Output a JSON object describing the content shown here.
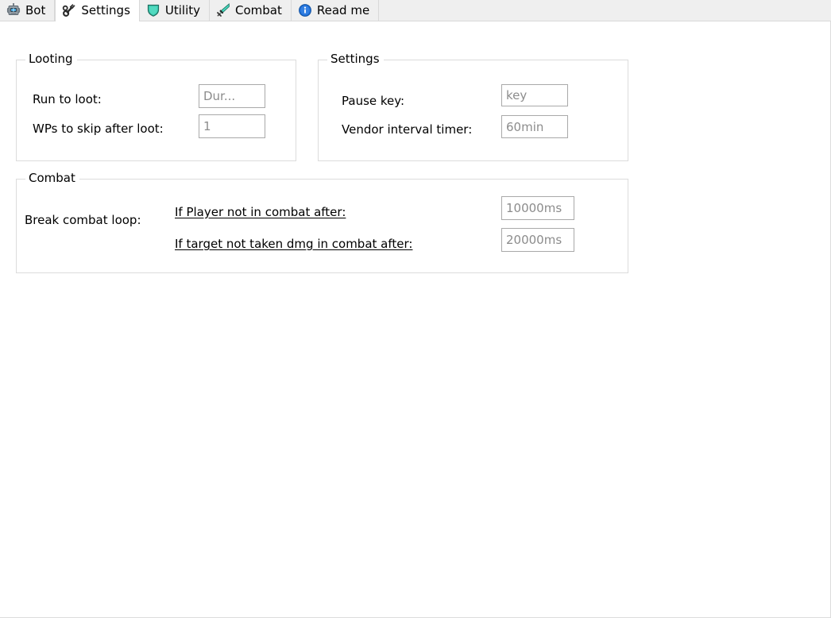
{
  "tabs": [
    {
      "label": "Bot",
      "icon": "robot-icon",
      "selected": false
    },
    {
      "label": "Settings",
      "icon": "wrench-icon",
      "selected": true
    },
    {
      "label": "Utility",
      "icon": "shield-icon",
      "selected": false
    },
    {
      "label": "Combat",
      "icon": "sword-icon",
      "selected": false
    },
    {
      "label": "Read me",
      "icon": "info-icon",
      "selected": false
    }
  ],
  "groups": {
    "looting": {
      "title": "Looting",
      "run_to_loot": {
        "label": "Run to loot:",
        "value": "",
        "placeholder": "Dur..."
      },
      "wps_to_skip": {
        "label": "WPs to skip after loot:",
        "value": "",
        "placeholder": "1"
      }
    },
    "settings": {
      "title": "Settings",
      "pause_key": {
        "label": "Pause key:",
        "value": "",
        "placeholder": "key"
      },
      "vendor_interval": {
        "label": "Vendor interval timer:",
        "value": "",
        "placeholder": "60min"
      }
    },
    "combat": {
      "title": "Combat",
      "break_combat_loop_label": "Break combat loop:",
      "if_player_not_in_combat": {
        "label": "If Player not in combat after:",
        "value": "",
        "placeholder": "10000ms"
      },
      "if_target_not_taken_dmg": {
        "label": "If target not taken dmg in combat after:",
        "value": "",
        "placeholder": "20000ms"
      }
    }
  },
  "colors": {
    "tab_selected_bg": "#ffffff",
    "tab_bg": "#efefef",
    "panel_bg": "#ffffff",
    "group_border": "#dcdcdc",
    "input_border": "#a9a9a9",
    "placeholder_text": "#8c8c8c",
    "shield_icon": "#3ecfb4",
    "sword_icon": "#3ecfb4",
    "info_icon": "#1e6fd9",
    "robot_icon": "#4aa8e0"
  }
}
